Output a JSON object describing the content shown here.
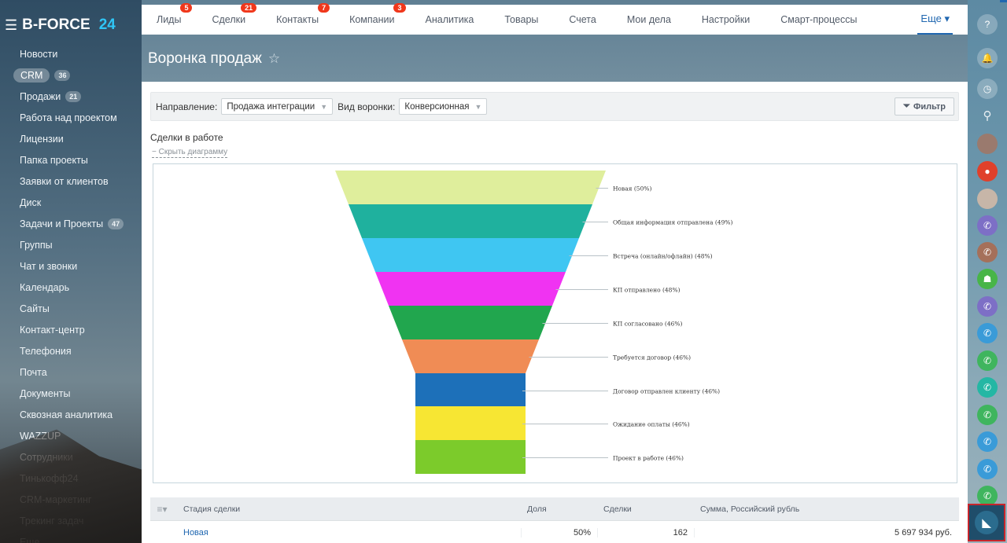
{
  "app": {
    "name": "B-FORCE",
    "version": "24"
  },
  "sidebar": {
    "items": [
      {
        "label": "Новости"
      },
      {
        "label": "CRM",
        "count": "36",
        "active": true
      },
      {
        "label": "Продажи",
        "count": "21"
      },
      {
        "label": "Работа над проектом"
      },
      {
        "label": "Лицензии"
      },
      {
        "label": "Папка проекты"
      },
      {
        "label": "Заявки от клиентов"
      },
      {
        "label": "Диск"
      },
      {
        "label": "Задачи и Проекты",
        "count": "47"
      },
      {
        "label": "Группы"
      },
      {
        "label": "Чат и звонки"
      },
      {
        "label": "Календарь"
      },
      {
        "label": "Сайты"
      },
      {
        "label": "Контакт-центр"
      },
      {
        "label": "Телефония"
      },
      {
        "label": "Почта"
      },
      {
        "label": "Документы"
      },
      {
        "label": "Сквозная аналитика"
      },
      {
        "label": "WAZZUP"
      },
      {
        "label": "Сотрудники"
      },
      {
        "label": "Тинькофф24"
      },
      {
        "label": "CRM-маркетинг"
      },
      {
        "label": "Трекинг задач"
      },
      {
        "label": "Еще"
      }
    ]
  },
  "topnav": {
    "items": [
      {
        "label": "Лиды",
        "badge": "5"
      },
      {
        "label": "Сделки",
        "badge": "21"
      },
      {
        "label": "Контакты",
        "badge": "7"
      },
      {
        "label": "Компании",
        "badge": "3"
      },
      {
        "label": "Аналитика"
      },
      {
        "label": "Товары"
      },
      {
        "label": "Счета"
      },
      {
        "label": "Мои дела"
      },
      {
        "label": "Настройки"
      },
      {
        "label": "Смарт-процессы"
      }
    ],
    "more_label": "Еще ▾"
  },
  "page": {
    "title": "Воронка продаж",
    "star_icon": "star-icon"
  },
  "filters": {
    "direction_label": "Направление:",
    "direction_value": "Продажа интеграции",
    "view_label": "Вид воронки:",
    "view_value": "Конверсионная",
    "filter_button": "Фильтр"
  },
  "section": {
    "title": "Сделки в работе",
    "hide_link": "− Скрыть диаграмму"
  },
  "chart_data": {
    "type": "funnel",
    "stages": [
      {
        "label": "Новая (50%)",
        "color": "#dfee9c"
      },
      {
        "label": "Общая информация отправлена (49%)",
        "color": "#1fb19e"
      },
      {
        "label": "Встреча (онлайн/офлайн) (48%)",
        "color": "#3fc6f2"
      },
      {
        "label": "КП отправлено (48%)",
        "color": "#f033f2"
      },
      {
        "label": "КП согласовано (46%)",
        "color": "#21a64e"
      },
      {
        "label": "Требуется договор (46%)",
        "color": "#f08c55"
      },
      {
        "label": "Договор отправлен клиенту (46%)",
        "color": "#1d70b9"
      },
      {
        "label": "Ожидание оплаты (46%)",
        "color": "#f7e633"
      },
      {
        "label": "Проект в работе (46%)",
        "color": "#7ccb2b"
      }
    ]
  },
  "table": {
    "columns": [
      "Стадия сделки",
      "Доля",
      "Сделки",
      "Сумма, Российский рубль"
    ],
    "rows": [
      {
        "stage": "Новая",
        "share": "50%",
        "deals": "162",
        "sum": "5 697 934 руб."
      }
    ]
  },
  "rightbar": {
    "icons": [
      "help-icon",
      "bell-icon",
      "clock-icon",
      "search-icon"
    ]
  }
}
